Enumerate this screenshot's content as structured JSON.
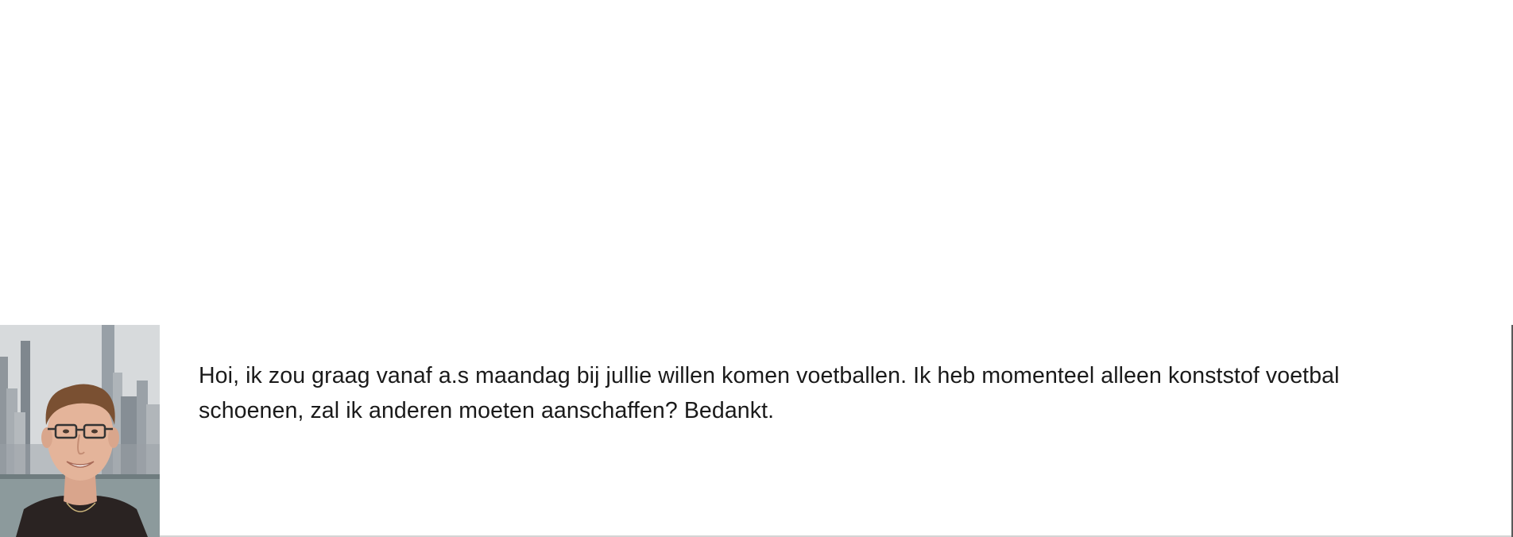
{
  "comment": {
    "avatar_icon": "user-photo",
    "text": "Hoi, ik zou graag vanaf a.s maandag bij jullie willen komen voetballen. Ik heb momenteel alleen konststof voetbal schoenen, zal ik anderen moeten aanschaffen? Bedankt."
  },
  "colors": {
    "text": "#1a1a1a",
    "background": "#ffffff",
    "divider": "#d4d4d4",
    "right_border": "#5a5a5a"
  }
}
